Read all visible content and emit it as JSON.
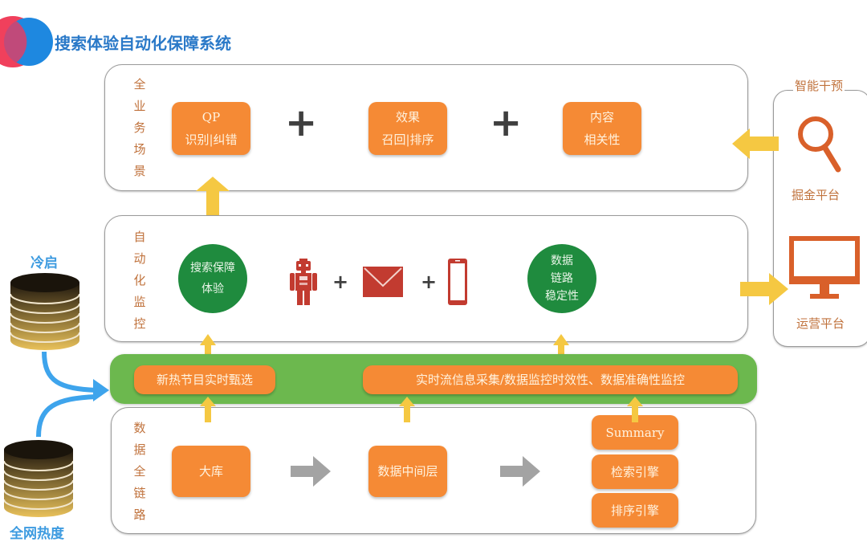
{
  "header": {
    "title": "搜索体验自动化保障系统",
    "logo_icon": "overlapping-circles-logo-icon",
    "colors": {
      "logo_left": "#f0405c",
      "logo_right": "#1e88e0",
      "title": "#2a79c8"
    }
  },
  "colors": {
    "orange_box": "#f58a35",
    "green_circle": "#1f8b3e",
    "green_bar": "#6cb84e",
    "arrow_yellow": "#f5c842",
    "icon_red": "#c23b30",
    "icon_orange": "#d9602a",
    "label_brown": "#c0723c",
    "source_blue": "#3d9be0"
  },
  "scenario_panel": {
    "label": [
      "全",
      "业",
      "务",
      "场",
      "景"
    ],
    "boxes": [
      {
        "line1": "QP",
        "line2": "识别|纠错"
      },
      {
        "line1": "效果",
        "line2": "召回|排序"
      },
      {
        "line1": "内容",
        "line2": "相关性"
      }
    ],
    "operators": [
      "+",
      "+"
    ]
  },
  "monitor_panel": {
    "label": [
      "自",
      "动",
      "化",
      "监",
      "控"
    ],
    "circle_left": {
      "line1": "搜索保障",
      "line2": "体验"
    },
    "alert_icons": [
      "robot-icon",
      "envelope-icon",
      "smartphone-icon"
    ],
    "operators": [
      "+",
      "+"
    ],
    "circle_right": {
      "line1": "数据",
      "line2": "链路",
      "line3": "稳定性"
    }
  },
  "realtime_bar": {
    "left_box": "新热节目实时甄选",
    "right_box": "实时流信息采集/数据监控时效性、数据准确性监控"
  },
  "data_panel": {
    "label": [
      "数",
      "据",
      "全",
      "链",
      "路"
    ],
    "box_source": "大库",
    "box_middle": "数据中间层",
    "engines": [
      "Summary",
      "检索引擎",
      "排序引擎"
    ]
  },
  "sources": {
    "cold_start": "冷启",
    "web_heat": "全网热度"
  },
  "intervention": {
    "title": "智能干预",
    "mining_platform": "掘金平台",
    "ops_platform": "运营平台"
  }
}
